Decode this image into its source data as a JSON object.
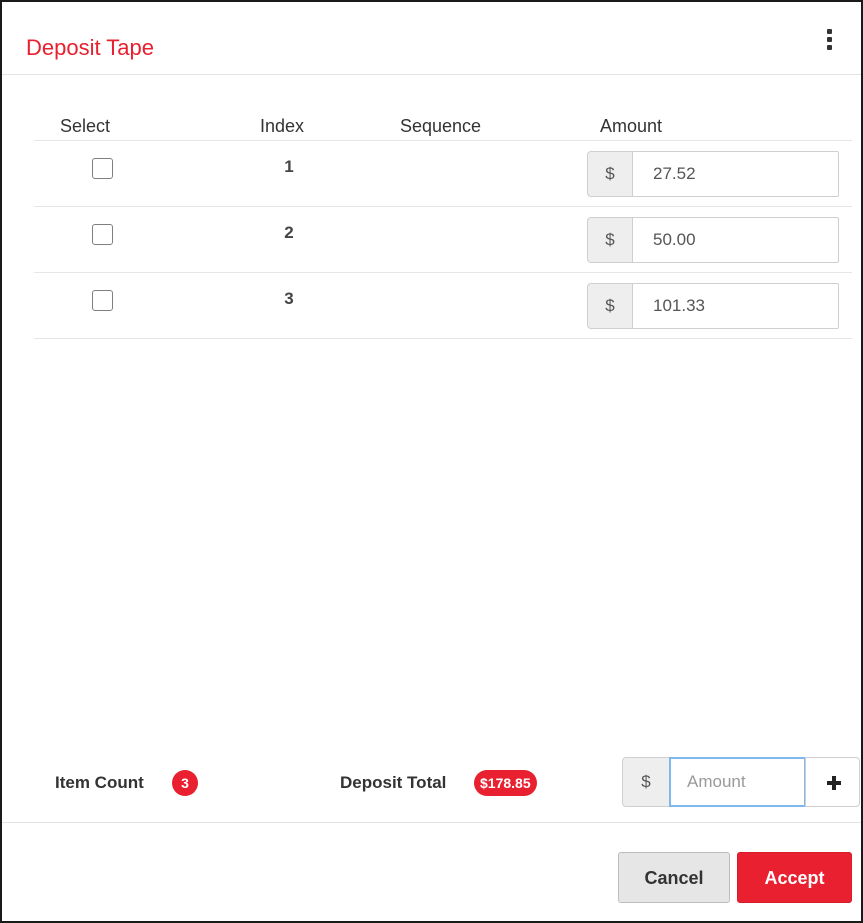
{
  "dialog": {
    "title": "Deposit Tape",
    "menu_icon": "kebab-menu-icon"
  },
  "table": {
    "headers": {
      "select": "Select",
      "index": "Index",
      "sequence": "Sequence",
      "amount": "Amount"
    },
    "currency_symbol": "$",
    "rows": [
      {
        "index": "1",
        "sequence": "",
        "amount": "27.52",
        "selected": false
      },
      {
        "index": "2",
        "sequence": "",
        "amount": "50.00",
        "selected": false
      },
      {
        "index": "3",
        "sequence": "",
        "amount": "101.33",
        "selected": false
      }
    ]
  },
  "summary": {
    "item_count_label": "Item Count",
    "item_count": "3",
    "deposit_total_label": "Deposit Total",
    "deposit_total": "$178.85"
  },
  "new_amount": {
    "currency_symbol": "$",
    "placeholder": "Amount",
    "value": "",
    "add_icon": "plus-icon"
  },
  "actions": {
    "cancel_label": "Cancel",
    "accept_label": "Accept"
  },
  "colors": {
    "accent": "#e8202f",
    "focus_border": "#7fb8ec"
  }
}
